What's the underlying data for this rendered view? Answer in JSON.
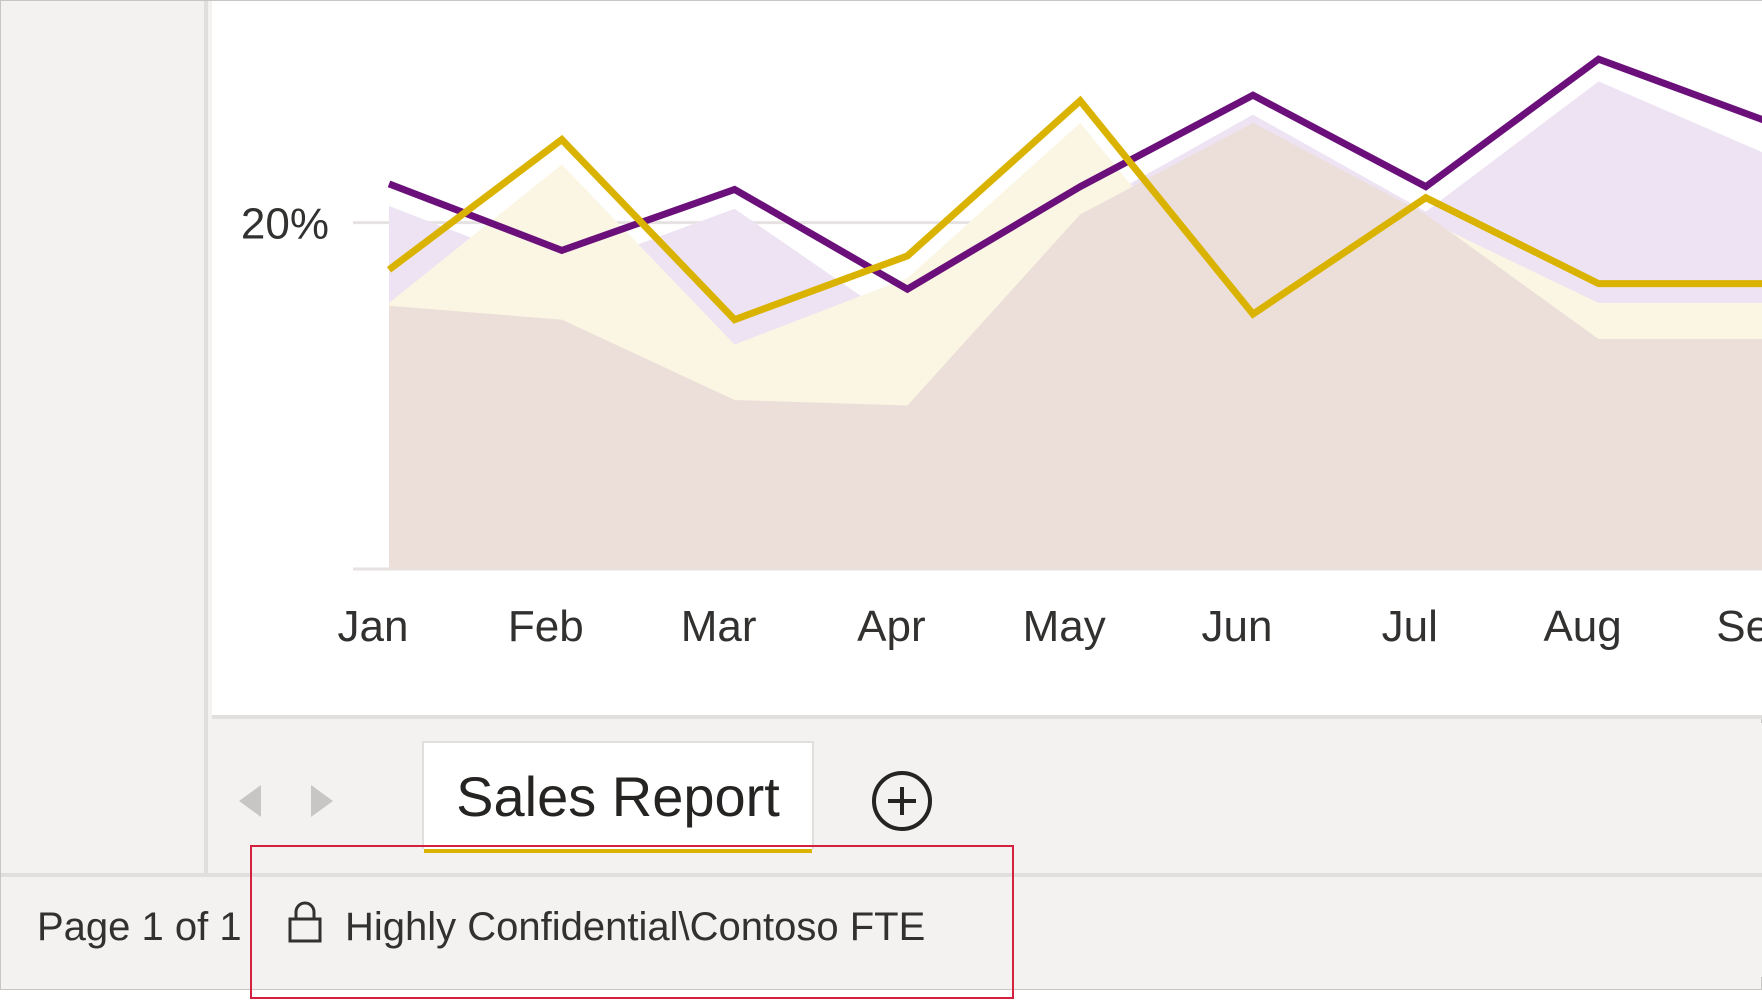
{
  "chart_data": {
    "type": "line",
    "categories": [
      "Jan",
      "Feb",
      "Mar",
      "Apr",
      "May",
      "Jun",
      "Jul",
      "Aug",
      "Sep"
    ],
    "y_tick_label": "20%",
    "series": [
      {
        "color": "#6b0f7a",
        "values": [
          21.4,
          19.0,
          21.2,
          17.6,
          21.3,
          24.6,
          21.3,
          25.9,
          23.6
        ]
      },
      {
        "color": "#d9b300",
        "values": [
          18.3,
          23.0,
          16.5,
          18.8,
          24.4,
          16.7,
          20.9,
          17.8,
          17.8
        ]
      }
    ],
    "areas": [
      {
        "color": "#eee3f3",
        "values": [
          20.6,
          18.2,
          20.5,
          16.2,
          20.4,
          23.9,
          20.4,
          25.1,
          22.4
        ]
      },
      {
        "color": "#faf6e3",
        "values": [
          17.1,
          22.1,
          15.6,
          18.0,
          23.6,
          16.0,
          20.1,
          17.1,
          17.1
        ]
      },
      {
        "color": "#ecdfd9",
        "values": [
          17.0,
          16.5,
          13.6,
          13.4,
          20.3,
          23.6,
          20.3,
          15.8,
          15.8
        ]
      }
    ],
    "ylim": [
      7.5,
      28.0
    ],
    "grid": true
  },
  "nav": {
    "prev_icon": "chevron-left-icon",
    "next_icon": "chevron-right-icon"
  },
  "tab": {
    "label": "Sales Report"
  },
  "add_icon": "plus-circle-icon",
  "status": {
    "page": "Page 1 of 1",
    "sensitivity_icon": "lock-icon",
    "sensitivity_label": "Highly Confidential\\Contoso FTE"
  },
  "colors": {
    "accent": "#d9b300",
    "highlight": "#d4213d"
  }
}
